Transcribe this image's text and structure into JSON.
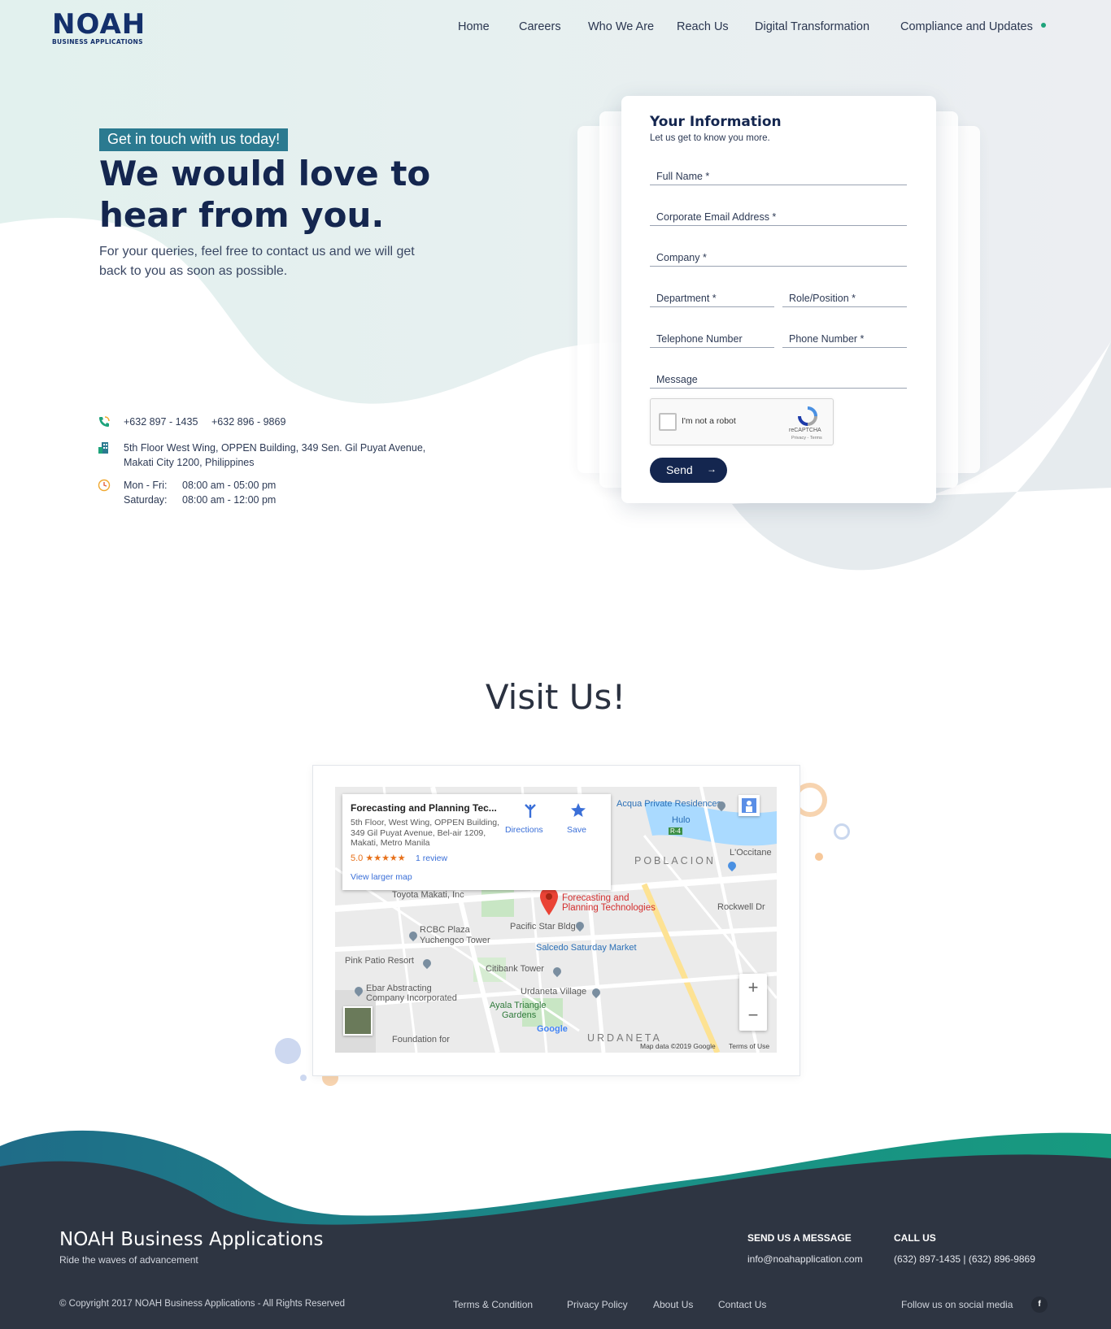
{
  "header": {
    "logo_text": "NOAH",
    "logo_subtext": "BUSINESS APPLICATIONS",
    "nav": [
      "Home",
      "Careers",
      "Who We Are",
      "Reach Us",
      "Digital Transformation",
      "Compliance and Updates"
    ]
  },
  "hero": {
    "badge": "Get in touch with us today!",
    "title": "We would love to hear from you.",
    "subtitle": "For your queries, feel free to contact us and we will get back to you as soon as possible."
  },
  "contact": {
    "phone_icon": "phone-icon",
    "phone1": "+632 897 - 1435",
    "phone2": "+632 896 - 9869",
    "address_icon": "building-icon",
    "address_line1": "5th Floor West Wing, OPPEN Building,  349 Sen. Gil Puyat Avenue,",
    "address_line2": "Makati City 1200, Philippines",
    "hours_icon": "clock-icon",
    "hours": [
      {
        "days": "Mon - Fri:",
        "time": "08:00 am - 05:00 pm"
      },
      {
        "days": "Saturday:",
        "time": "08:00 am - 12:00 pm"
      }
    ]
  },
  "form": {
    "title": "Your Information",
    "subtitle": "Let us get to know you more.",
    "full_name": "Full Name *",
    "email": "Corporate Email Address *",
    "company": "Company *",
    "department": "Department *",
    "role": "Role/Position *",
    "telephone": "Telephone Number",
    "phone": "Phone Number *",
    "message": "Message",
    "captcha_label": "I'm not a robot",
    "captcha_brand": "reCAPTCHA",
    "captcha_terms": "Privacy - Terms",
    "send": "Send"
  },
  "visit": {
    "title": "Visit Us!",
    "map": {
      "popup_title": "Forecasting and Planning Tec...",
      "popup_address": "5th Floor, West Wing, OPPEN Building, 349 Gil Puyat Avenue, Bel-air 1209, Makati, Metro Manila",
      "rating": "5.0 ★★★★★",
      "reviews": "1 review",
      "larger_map": "View larger map",
      "directions": "Directions",
      "save": "Save",
      "marker_label_1": "Forecasting and",
      "marker_label_2": "Planning Technologies",
      "labels": {
        "acqua": "Acqua Private Residences",
        "hulo": "Hulo",
        "r4": "R-4",
        "poblacion": "POBLACION",
        "loccitane": "L'Occitane",
        "rockwell": "Rockwell Dr",
        "toyota": "Toyota Makati, Inc",
        "pacific": "Pacific Star Bldg",
        "rcbc1": "RCBC Plaza",
        "rcbc2": "Yuchengco Tower",
        "salcedo": "Salcedo Saturday Market",
        "pinkpatio": "Pink Patio Resort",
        "citibank": "Citibank Tower",
        "urdaneta_village": "Urdaneta Village",
        "ebar1": "Ebar Abstracting",
        "ebar2": "Company Incorporated",
        "ayala1": "Ayala Triangle",
        "ayala2": "Gardens",
        "foundation": "Foundation for",
        "urdaneta": "URDANETA",
        "google": "Google"
      },
      "attribution": "Map data ©2019 Google",
      "terms": "Terms of Use",
      "zoom_in": "+",
      "zoom_out": "−"
    }
  },
  "footer": {
    "brand": "NOAH Business Applications",
    "tagline": "Ride the waves of advancement",
    "message_head": "SEND US A MESSAGE",
    "email": "info@noahapplication.com",
    "call_head": "CALL US",
    "call": "(632) 897-1435 | (632) 896-9869",
    "copyright": "© Copyright 2017 NOAH Business Applications - All Rights Reserved",
    "links": [
      "Terms & Condition",
      "Privacy Policy",
      "About Us",
      "Contact Us"
    ],
    "social_text": "Follow us on social media",
    "facebook": "f"
  }
}
